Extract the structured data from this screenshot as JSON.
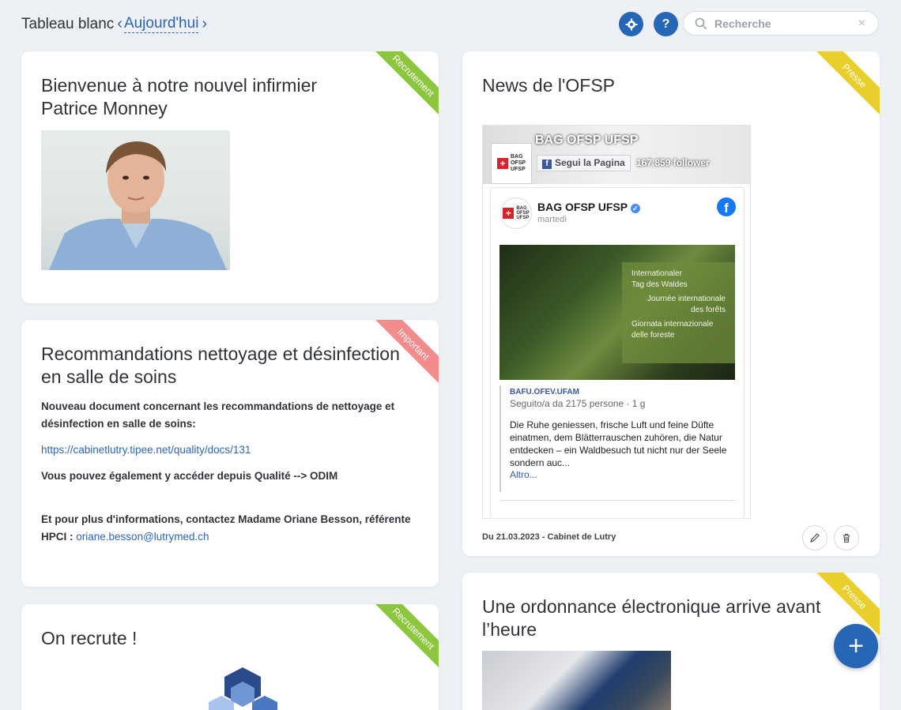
{
  "header": {
    "board_title": "Tableau blanc",
    "today_label": "Aujourd'hui",
    "settings_label": "⚙",
    "help_label": "?",
    "search_placeholder": "Recherche",
    "search_clear": "×"
  },
  "cards": {
    "welcome": {
      "ribbon": "Recrutement",
      "title_line1": "Bienvenue à notre nouvel infirmier",
      "title_line2": "Patrice Monney"
    },
    "recommandations": {
      "ribbon": "Important",
      "title_line1": "Recommandations nettoyage et désinfection",
      "title_line2": "en salle de soins",
      "para1": "Nouveau document concernant les recommandations de nettoyage et désinfection en salle de soins:",
      "link": "https://cabinetlutry.tipee.net/quality/docs/131",
      "para2": "Vous pouvez également y accéder depuis Qualité --> ODIM",
      "para3": "Et pour plus d'informations, contactez Madame Oriane Besson, référente HPCI :",
      "email": "oriane.besson@lutrymed.ch"
    },
    "recrute": {
      "ribbon": "Recrutement",
      "title": "On recrute !"
    },
    "news": {
      "ribbon": "Presse",
      "title": "News de l'OFSP",
      "footer": "Du 21.03.2023 - Cabinet de Lutry",
      "fb": {
        "page_name": "BAG OFSP UFSP",
        "follow_label": "Segui la Pagina",
        "followers": "167.859 follower",
        "logo_text": "BAG\nOFSP\nUFSP",
        "post_name": "BAG OFSP UFSP",
        "post_date": "martedì",
        "image_lines": [
          "Internationaler",
          "Tag des Waldes",
          "Journée internationale",
          "des forêts",
          "Giornata internazionale",
          "delle foreste"
        ],
        "link_domain": "BAFU.OFEV.UFAM",
        "link_sub": "Seguito/a da 2175 persone · 1 g",
        "link_text": "Die Ruhe geniessen, frische Luft und feine Düfte einatmen, dem Blätterrauschen zuhören, die Natur entdecken – ein Waldbesuch tut nicht nur der Seele sondern auc...",
        "link_more": "Altro..."
      }
    },
    "ordonnance": {
      "ribbon": "Presse",
      "title_line1": "Une ordonnance électronique arrive avant",
      "title_line2": "l’heure"
    }
  },
  "fab_label": "+",
  "colors": {
    "accent": "#2566b5",
    "ribbon_green": "#8cc63f",
    "ribbon_red": "#f28b8b",
    "ribbon_yellow": "#e8cf2c",
    "background": "#edf0f5"
  }
}
